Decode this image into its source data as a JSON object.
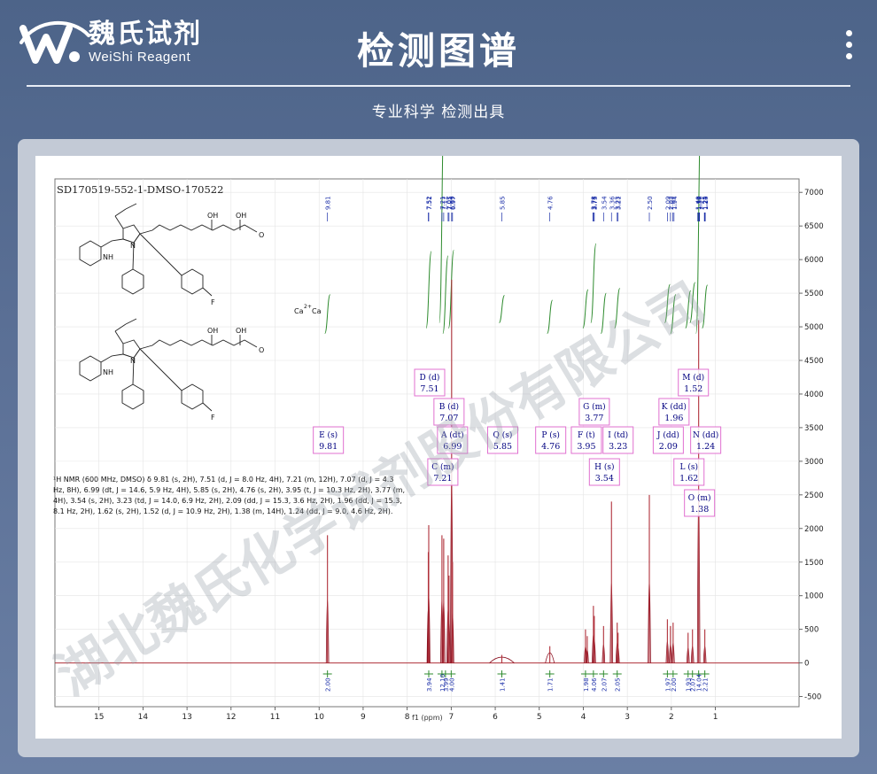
{
  "brand": {
    "name_cn": "魏氏试剂",
    "name_en": "WeiShi Reagent"
  },
  "header": {
    "title": "检测图谱",
    "tagline": "专业科学  检测出具"
  },
  "watermark": "湖北魏氏化学试剂股份有限公司",
  "colors": {
    "spectrum": "#b0303a",
    "integral": "#2e8b2e",
    "label_box": "#e070d0",
    "label_text": "#000080",
    "peak_label": "#1a2ea8"
  },
  "chart_data": {
    "type": "line",
    "title": "SD170519-552-1-DMSO-170522",
    "xlabel": "f1 (ppm)",
    "ylabel": "",
    "xlim": [
      16,
      -0.9
    ],
    "ylim": [
      -650,
      7200
    ],
    "x_ticks": [
      "15",
      "14",
      "13",
      "12",
      "11",
      "10",
      "9",
      "8",
      "7",
      "6",
      "5",
      "4",
      "3",
      "2",
      "1"
    ],
    "y_ticks": [
      "7000",
      "6500",
      "6000",
      "5500",
      "5000",
      "4500",
      "4000",
      "3500",
      "3000",
      "2500",
      "2000",
      "1500",
      "1000",
      "500",
      "0",
      "-500"
    ],
    "peaks": [
      {
        "x": 9.81,
        "y": 1900
      },
      {
        "x": 7.52,
        "y": 1650
      },
      {
        "x": 7.51,
        "y": 2050
      },
      {
        "x": 7.21,
        "y": 1900
      },
      {
        "x": 7.17,
        "y": 1850
      },
      {
        "x": 7.07,
        "y": 1600
      },
      {
        "x": 7.05,
        "y": 1300
      },
      {
        "x": 6.99,
        "y": 5700
      },
      {
        "x": 6.97,
        "y": 1500
      },
      {
        "x": 5.85,
        "y": 120
      },
      {
        "x": 4.76,
        "y": 250
      },
      {
        "x": 3.95,
        "y": 500
      },
      {
        "x": 3.91,
        "y": 400
      },
      {
        "x": 3.77,
        "y": 850
      },
      {
        "x": 3.75,
        "y": 700
      },
      {
        "x": 3.54,
        "y": 550
      },
      {
        "x": 3.36,
        "y": 2400
      },
      {
        "x": 3.23,
        "y": 600
      },
      {
        "x": 3.21,
        "y": 450
      },
      {
        "x": 2.5,
        "y": 2500
      },
      {
        "x": 2.09,
        "y": 650
      },
      {
        "x": 2.02,
        "y": 550
      },
      {
        "x": 1.96,
        "y": 600
      },
      {
        "x": 1.62,
        "y": 450
      },
      {
        "x": 1.52,
        "y": 500
      },
      {
        "x": 1.38,
        "y": 5100
      },
      {
        "x": 1.24,
        "y": 500
      }
    ],
    "peak_labels": [
      "9.81",
      "7.52",
      "7.51",
      "7.21",
      "7.17",
      "7.07",
      "7.05",
      "6.99",
      "6.97",
      "5.85",
      "4.76",
      "3.78",
      "3.77",
      "3.75",
      "3.54",
      "3.36",
      "3.23",
      "3.21",
      "2.50",
      "2.09",
      "2.02",
      "1.97",
      "1.94",
      "1.40",
      "1.39",
      "1.37",
      "1.36",
      "1.25",
      "1.24",
      "1.23"
    ],
    "multiplets": [
      {
        "letter": "D",
        "mult": "d",
        "shift": "7.51",
        "x": 7.51
      },
      {
        "letter": "B",
        "mult": "d",
        "shift": "7.07",
        "x": 7.07
      },
      {
        "letter": "A",
        "mult": "dt",
        "shift": "6.99",
        "x": 6.99
      },
      {
        "letter": "C",
        "mult": "m",
        "shift": "7.21",
        "x": 7.21
      },
      {
        "letter": "E",
        "mult": "s",
        "shift": "9.81",
        "x": 9.81
      },
      {
        "letter": "Q",
        "mult": "s",
        "shift": "5.85",
        "x": 5.85
      },
      {
        "letter": "P",
        "mult": "s",
        "shift": "4.76",
        "x": 4.76
      },
      {
        "letter": "G",
        "mult": "m",
        "shift": "3.77",
        "x": 3.77
      },
      {
        "letter": "F",
        "mult": "t",
        "shift": "3.95",
        "x": 3.95
      },
      {
        "letter": "I",
        "mult": "td",
        "shift": "3.23",
        "x": 3.23
      },
      {
        "letter": "H",
        "mult": "s",
        "shift": "3.54",
        "x": 3.54
      },
      {
        "letter": "M",
        "mult": "d",
        "shift": "1.52",
        "x": 1.52
      },
      {
        "letter": "K",
        "mult": "dd",
        "shift": "1.96",
        "x": 1.96
      },
      {
        "letter": "J",
        "mult": "dd",
        "shift": "2.09",
        "x": 2.09
      },
      {
        "letter": "N",
        "mult": "dd",
        "shift": "1.24",
        "x": 1.24
      },
      {
        "letter": "L",
        "mult": "s",
        "shift": "1.62",
        "x": 1.62
      },
      {
        "letter": "O",
        "mult": "m",
        "shift": "1.38",
        "x": 1.38
      }
    ],
    "integrals": [
      {
        "x": 9.81,
        "value": "2.00"
      },
      {
        "x": 7.51,
        "value": "3.94"
      },
      {
        "x": 7.21,
        "value": "12.10"
      },
      {
        "x": 7.13,
        "value": "3.99"
      },
      {
        "x": 7.0,
        "value": "4.00"
      },
      {
        "x": 5.85,
        "value": "1.41"
      },
      {
        "x": 4.76,
        "value": "1.71"
      },
      {
        "x": 3.95,
        "value": "1.98"
      },
      {
        "x": 3.77,
        "value": "4.06"
      },
      {
        "x": 3.54,
        "value": "2.07"
      },
      {
        "x": 3.23,
        "value": "2.05"
      },
      {
        "x": 2.09,
        "value": "1.97"
      },
      {
        "x": 1.96,
        "value": "2.00"
      },
      {
        "x": 1.62,
        "value": "1.93"
      },
      {
        "x": 1.52,
        "value": "2.07"
      },
      {
        "x": 1.38,
        "value": "14.04"
      },
      {
        "x": 1.24,
        "value": "2.21"
      }
    ],
    "nmr_text_lines": [
      "¹H NMR (600 MHz, DMSO) δ 9.81 (s, 2H), 7.51 (d, J = 8.0 Hz, 4H), 7.21 (m, 12H), 7.07 (d, J = 4.3",
      "Hz, 8H), 6.99 (dt, J = 14.6, 5.9 Hz, 4H), 5.85 (s, 2H), 4.76 (s, 2H), 3.95 (t, J = 10.3 Hz, 2H), 3.77 (m,",
      "4H), 3.54 (s, 2H), 3.23 (td, J = 14.0, 6.9 Hz, 2H), 2.09 (dd, J = 15.3, 3.6 Hz, 2H), 1.96 (dd, J = 15.3,",
      "8.1 Hz, 2H), 1.62 (s, 2H), 1.52 (d, J = 10.9 Hz, 2H), 1.38 (m, 14H), 1.24 (dd, J = 9.0, 4.6 Hz, 2H)."
    ],
    "structure_text": {
      "ca_label": "Ca",
      "ca_label2": "Ca",
      "ca_charge": "2+",
      "f_label": "F",
      "oh_label": "OH",
      "o_label": "O",
      "nh_label": "NH",
      "n_label": "N"
    },
    "grid": true
  }
}
